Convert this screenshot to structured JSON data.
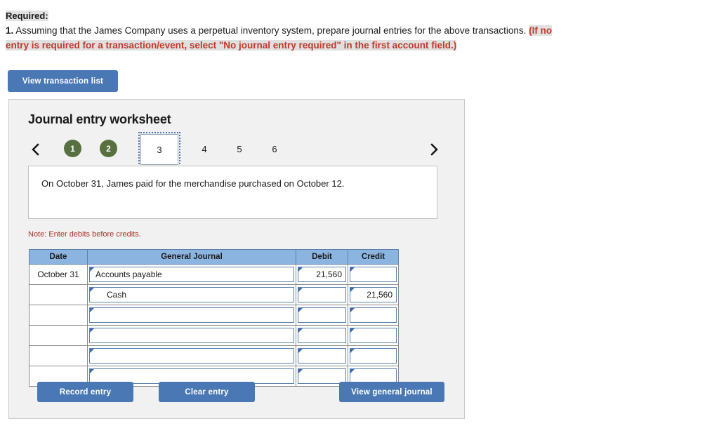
{
  "instructions": {
    "required_label": "Required:",
    "item_number": "1.",
    "item_text": "Assuming that the James Company uses a perpetual inventory system, prepare journal entries for the above transactions.",
    "highlight_line1": "(If no",
    "highlight_line2": "entry is required for a transaction/event, select \"No journal entry required\" in the first account field.)",
    "highlight_color": "#c0392b",
    "highlight_bg": "#e0e0e0"
  },
  "toolbar": {
    "view_transaction_list": "View transaction list",
    "button_color": "#4a78b5"
  },
  "worksheet": {
    "title": "Journal entry worksheet",
    "prev_icon": "chevron-left-icon",
    "next_icon": "chevron-right-icon",
    "tabs": [
      {
        "label": "1",
        "state": "done"
      },
      {
        "label": "2",
        "state": "done"
      },
      {
        "label": "3",
        "state": "current"
      },
      {
        "label": "4",
        "state": "pending"
      },
      {
        "label": "5",
        "state": "pending"
      },
      {
        "label": "6",
        "state": "pending"
      }
    ],
    "done_color": "#567040",
    "transaction_text": "On October 31, James paid for the merchandise purchased on October 12.",
    "note": "Note: Enter debits before credits."
  },
  "journal": {
    "headers": {
      "date": "Date",
      "general_journal": "General Journal",
      "debit": "Debit",
      "credit": "Credit"
    },
    "header_bg": "#8cb4e0",
    "rows": [
      {
        "date": "October 31",
        "account": "Accounts payable",
        "indent": false,
        "debit": "21,560",
        "credit": ""
      },
      {
        "date": "",
        "account": "Cash",
        "indent": true,
        "debit": "",
        "credit": "21,560"
      },
      {
        "date": "",
        "account": "",
        "indent": false,
        "debit": "",
        "credit": ""
      },
      {
        "date": "",
        "account": "",
        "indent": false,
        "debit": "",
        "credit": ""
      },
      {
        "date": "",
        "account": "",
        "indent": false,
        "debit": "",
        "credit": ""
      },
      {
        "date": "",
        "account": "",
        "indent": false,
        "debit": "",
        "credit": ""
      }
    ]
  },
  "actions": {
    "record_entry": "Record entry",
    "clear_entry": "Clear entry",
    "view_general_journal": "View general journal"
  }
}
